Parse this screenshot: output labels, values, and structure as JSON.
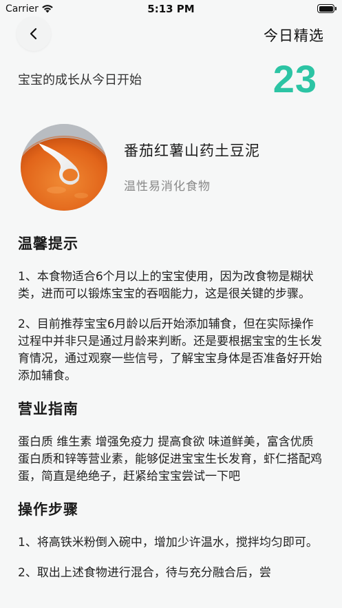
{
  "status_bar": {
    "carrier": "Carrier",
    "time": "5:13 PM"
  },
  "header": {
    "title": "今日精选",
    "back_icon": "chevron-left-icon"
  },
  "intro": {
    "tagline": "宝宝的成长从今日开始",
    "day_number": "23",
    "accent_color": "#2cc4a4"
  },
  "food": {
    "name": "番茄红薯山药土豆泥",
    "tag": "温性易消化食物"
  },
  "sections": [
    {
      "title": "温馨提示",
      "paragraphs": [
        "1、本食物适合6个月以上的宝宝使用，因为改食物是糊状类，进而可以锻炼宝宝的吞咽能力，这是很关键的步骤。",
        "2、目前推荐宝宝6月龄以后开始添加辅食，但在实际操作过程中并非只是通过月龄来判断。还是要根据宝宝的生长发育情况，通过观察一些信号，了解宝宝身体是否准备好开始添加辅食。"
      ]
    },
    {
      "title": "营业指南",
      "paragraphs": [
        "蛋白质 维生素 增强免疫力 提高食欲 味道鲜美，富含优质蛋白质和锌等营业素，能够促进宝宝生长发育，虾仁搭配鸡蛋，简直是绝绝子，赶紧给宝宝尝试一下吧"
      ]
    },
    {
      "title": "操作步骤",
      "paragraphs": [
        "1、将高铁米粉倒入碗中，增加少许温水，搅拌均匀即可。",
        "2、取出上述食物进行混合，待与充分融合后，尝"
      ]
    }
  ]
}
